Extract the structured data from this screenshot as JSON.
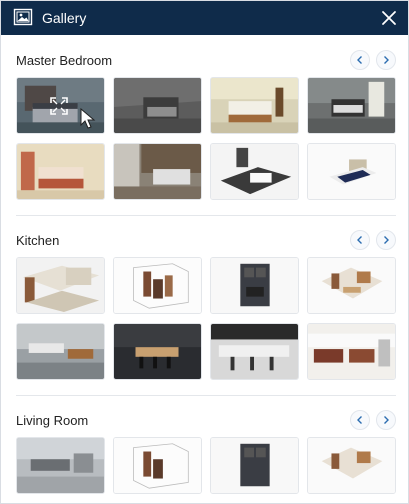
{
  "window": {
    "title": "Gallery"
  },
  "sections": [
    {
      "title": "Master Bedroom",
      "prev_icon": "chevron-left-icon",
      "next_icon": "chevron-right-icon"
    },
    {
      "title": "Kitchen",
      "prev_icon": "chevron-left-icon",
      "next_icon": "chevron-right-icon"
    },
    {
      "title": "Living Room",
      "prev_icon": "chevron-left-icon",
      "next_icon": "chevron-right-icon"
    }
  ],
  "colors": {
    "titlebar": "#0f2b4a",
    "accent": "#2b6cb0",
    "text": "#222222",
    "divider": "#e4e7eb"
  },
  "icons": {
    "title": "gallery-icon",
    "close": "close-icon",
    "expand": "expand-icon",
    "cursor": "cursor-icon"
  }
}
